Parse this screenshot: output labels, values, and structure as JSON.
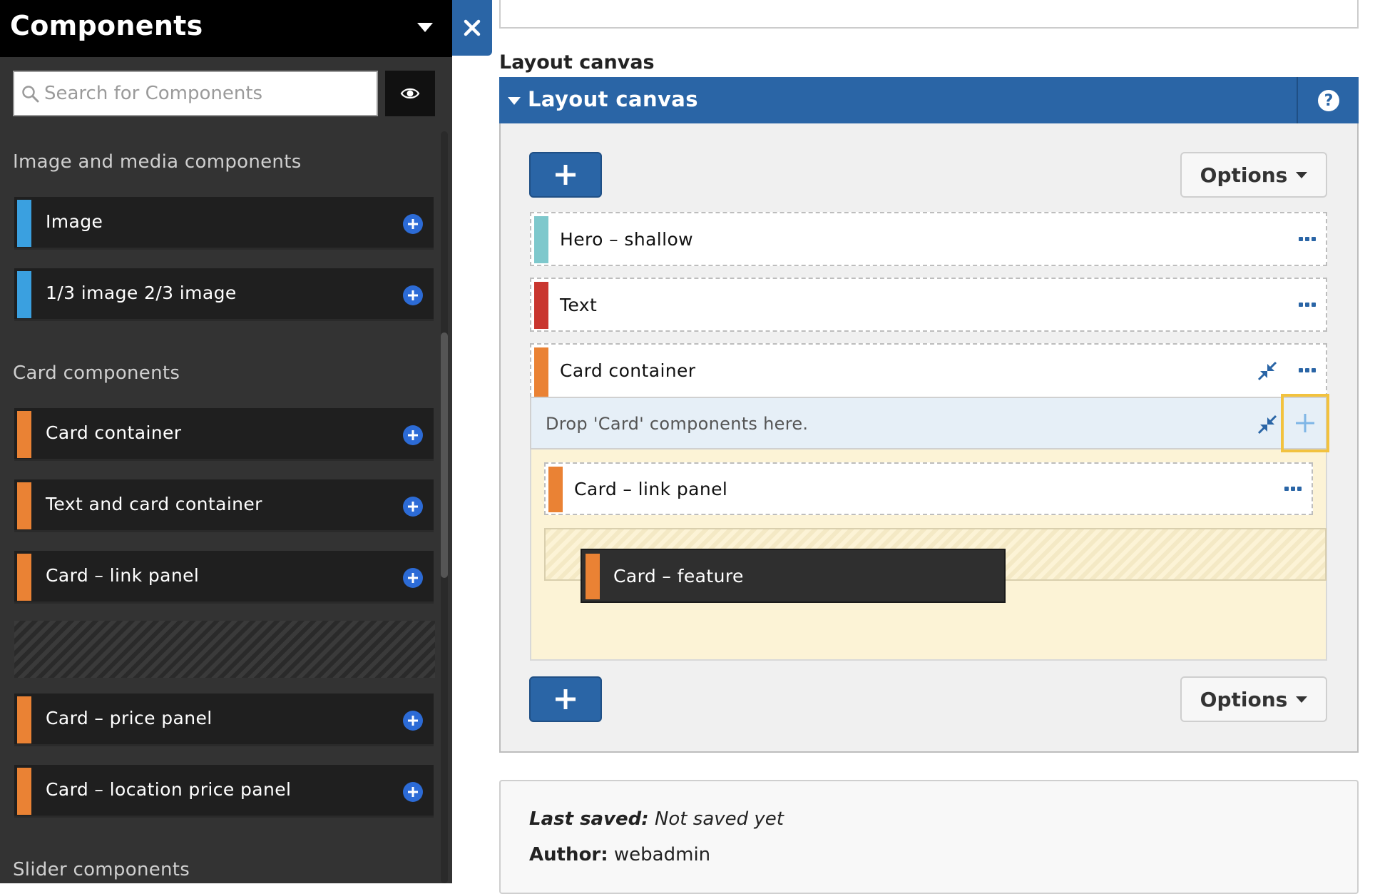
{
  "sidebar": {
    "title": "Components",
    "search_placeholder": "Search for Components",
    "groups": [
      {
        "heading": "Image and media components",
        "items": [
          {
            "label": "Image",
            "color": "#3aa0e0"
          },
          {
            "label": "1/3 image 2/3 image",
            "color": "#3aa0e0"
          }
        ]
      },
      {
        "heading": "Card components",
        "items": [
          {
            "label": "Card container",
            "color": "#ea8234"
          },
          {
            "label": "Text and card container",
            "color": "#ea8234"
          },
          {
            "label": "Card – link panel",
            "color": "#ea8234"
          },
          {
            "label": "Card – price panel",
            "color": "#ea8234"
          },
          {
            "label": "Card – location price panel",
            "color": "#ea8234"
          }
        ]
      },
      {
        "heading": "Slider components",
        "items": []
      }
    ]
  },
  "canvas": {
    "heading": "Layout canvas",
    "bar_title": "Layout canvas",
    "help_label": "?",
    "options_label": "Options",
    "rows": [
      {
        "label": "Hero – shallow",
        "color": "#7ec8cc"
      },
      {
        "label": "Text",
        "color": "#c9362f"
      },
      {
        "label": "Card container",
        "color": "#ea8234"
      }
    ],
    "drop_text": "Drop 'Card' components here.",
    "nested_card": {
      "label": "Card – link panel",
      "color": "#ea8234"
    },
    "dragging_card": {
      "label": "Card – feature",
      "color": "#ea8234"
    }
  },
  "info": {
    "last_saved_label": "Last saved:",
    "last_saved_value": "Not saved yet",
    "author_label": "Author:",
    "author_value": "webadmin"
  },
  "colors": {
    "accent": "#2a65a6",
    "sidebar_bg": "#333333",
    "highlight": "#f2c23e"
  }
}
